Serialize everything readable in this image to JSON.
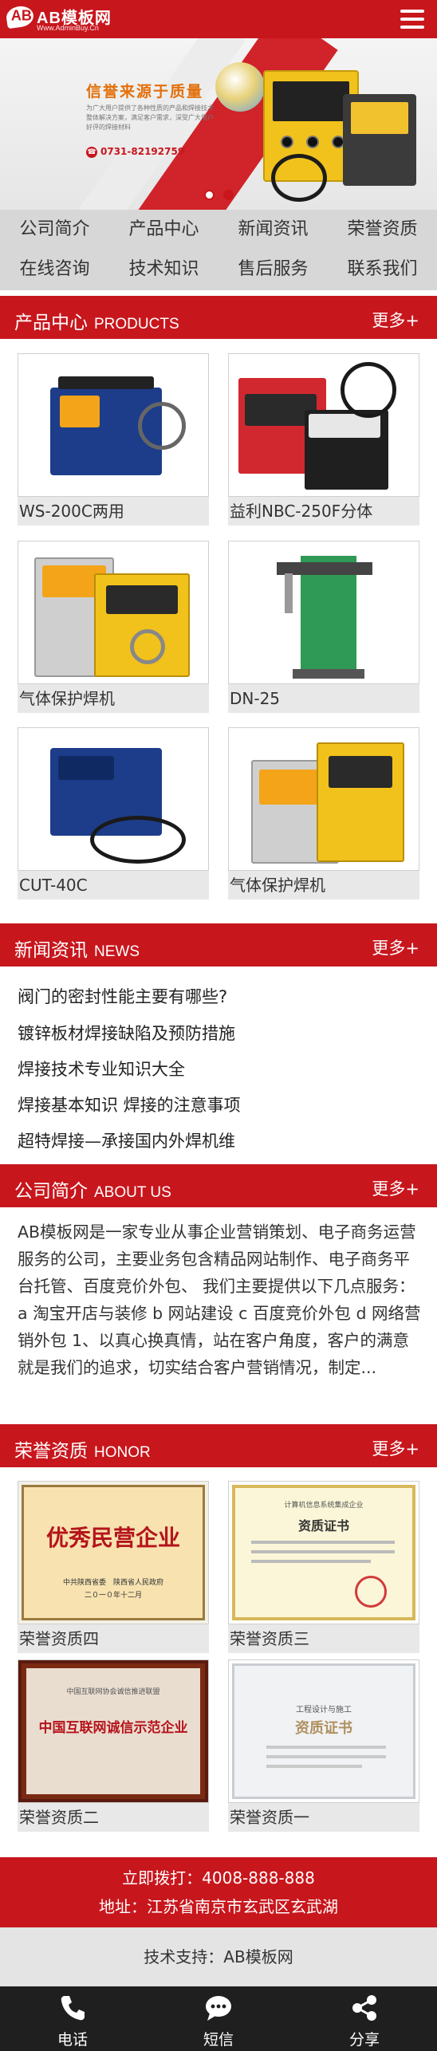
{
  "header": {
    "logo_mark": "AB",
    "logo_title": "AB模板网",
    "logo_url": "Www.AdminBuy.Cn"
  },
  "banner": {
    "slogan": "信誉来源于质量",
    "description": "为广大用户提供了各种性质的产品和焊接技术整体解决方案，满足客户需求，深受广大用户好评的焊接材料",
    "phone": "0731-82192759",
    "phone_icon": "phone-dot-icon",
    "slides": 2,
    "active_slide": 2
  },
  "quicknav": [
    {
      "label": "公司简介"
    },
    {
      "label": "产品中心"
    },
    {
      "label": "新闻资讯"
    },
    {
      "label": "荣誉资质"
    },
    {
      "label": "在线咨询"
    },
    {
      "label": "技术知识"
    },
    {
      "label": "售后服务"
    },
    {
      "label": "联系我们"
    }
  ],
  "sections": {
    "products": {
      "title": "产品中心",
      "en": "PRODUCTS",
      "more": "更多+"
    },
    "news": {
      "title": "新闻资讯",
      "en": "NEWS",
      "more": "更多+"
    },
    "about": {
      "title": "公司简介",
      "en": "ABOUT US",
      "more": "更多+"
    },
    "honor": {
      "title": "荣誉资质",
      "en": "HONOR",
      "more": "更多+"
    }
  },
  "products": [
    {
      "name": "WS-200C两用"
    },
    {
      "name": "益利NBC-250F分体"
    },
    {
      "name": "气体保护焊机"
    },
    {
      "name": "DN-25"
    },
    {
      "name": "CUT-40C"
    },
    {
      "name": "气体保护焊机"
    }
  ],
  "news": [
    {
      "title": "阀门的密封性能主要有哪些?"
    },
    {
      "title": "镀锌板材焊接缺陷及预防措施"
    },
    {
      "title": "焊接技术专业知识大全"
    },
    {
      "title": "焊接基本知识 焊接的注意事项"
    },
    {
      "title": "超特焊接—承接国内外焊机维"
    }
  ],
  "about": {
    "text": "AB模板网是一家专业从事企业营销策划、电子商务运营服务的公司，主要业务包含精品网站制作、电子商务平台托管、百度竞价外包、 我们主要提供以下几点服务： a 淘宝开店与装修 b 网站建设 c 百度竞价外包 d 网络营销外包 1、以真心换真情，站在客户角度，客户的满意就是我们的追求，切实结合客户营销情况，制定..."
  },
  "honors": [
    {
      "name": "荣誉资质四",
      "image_text": "优秀民营企业",
      "image_sub": "中共陕西省委　陕西省人民政府",
      "image_date": "二０一０年十二月"
    },
    {
      "name": "荣誉资质三",
      "image_text": "资质证书",
      "image_header": "计算机信息系统集成企业"
    },
    {
      "name": "荣誉资质二",
      "image_text": "中国互联网诚信示范企业",
      "image_header": "中国互联网协会诚信推进联盟"
    },
    {
      "name": "荣誉资质一",
      "image_text": "资质证书",
      "image_header": "工程设计与施工"
    }
  ],
  "footer": {
    "phone_line": "立即拨打：4008-888-888",
    "address_line": "地址：江苏省南京市玄武区玄武湖",
    "support_line": "技术支持：AB模板网"
  },
  "tabbar": [
    {
      "label": "电话",
      "icon": "phone-icon"
    },
    {
      "label": "短信",
      "icon": "message-icon"
    },
    {
      "label": "分享",
      "icon": "share-icon"
    }
  ],
  "colors": {
    "brand_red": "#c8161d",
    "nav_gray": "#d7d7d7",
    "tabbar_dark": "#1f1f1f"
  }
}
